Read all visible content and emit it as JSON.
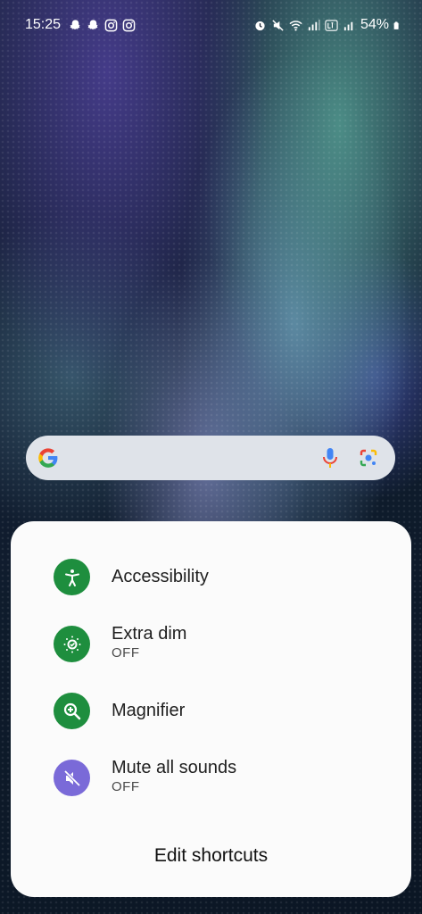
{
  "status_bar": {
    "time": "15:25",
    "battery": "54%",
    "left_icons": [
      "snapchat-icon",
      "snapchat-icon",
      "instagram-icon",
      "instagram-icon"
    ],
    "right_icons": [
      "alarm-icon",
      "mute-icon",
      "wifi-icon",
      "signal-icon",
      "volte-lte2-icon",
      "signal-icon",
      "battery-icon"
    ]
  },
  "search_bar": {
    "icons": [
      "google-logo-icon",
      "microphone-icon",
      "google-lens-icon"
    ]
  },
  "shortcuts_sheet": {
    "items": [
      {
        "title": "Accessibility",
        "subtitle": "",
        "icon": "accessibility-icon",
        "color": "#1e8e3e"
      },
      {
        "title": "Extra dim",
        "subtitle": "OFF",
        "icon": "extra-dim-icon",
        "color": "#1e8e3e"
      },
      {
        "title": "Magnifier",
        "subtitle": "",
        "icon": "magnifier-icon",
        "color": "#1e8e3e"
      },
      {
        "title": "Mute all sounds",
        "subtitle": "OFF",
        "icon": "mute-all-sounds-icon",
        "color": "#7a6ad8"
      }
    ],
    "edit_label": "Edit shortcuts"
  }
}
